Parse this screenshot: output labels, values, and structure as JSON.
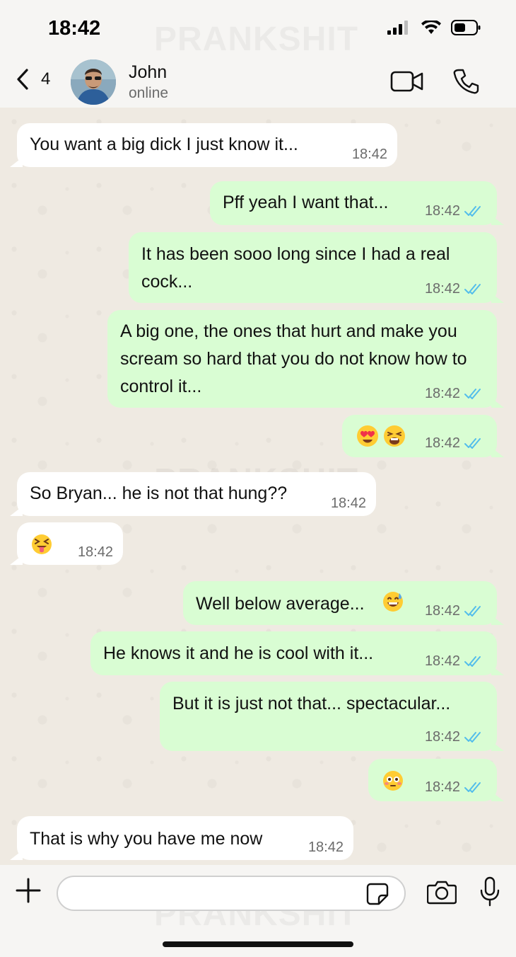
{
  "status_bar": {
    "time": "18:42"
  },
  "watermark": "PRANKSHIT",
  "header": {
    "back_count": "4",
    "contact_name": "John",
    "contact_status": "online"
  },
  "messages": [
    {
      "direction": "in",
      "text": "You want a big dick I just know it...",
      "time": "18:42"
    },
    {
      "direction": "out",
      "text": "Pff yeah I want that...",
      "time": "18:42",
      "status": "read"
    },
    {
      "direction": "out",
      "text": "It has been sooo long since I had a real cock...",
      "time": "18:42",
      "status": "read"
    },
    {
      "direction": "out",
      "text": "A big one, the ones that hurt and make you scream so hard that you do not know how to control it...",
      "time": "18:42",
      "status": "read"
    },
    {
      "direction": "out",
      "emojis": [
        "smiling-face-with-heart-eyes",
        "tired-face"
      ],
      "time": "18:42",
      "status": "read"
    },
    {
      "direction": "in",
      "text": "So Bryan... he is not that hung??",
      "time": "18:42"
    },
    {
      "direction": "in",
      "emojis": [
        "squinting-face-with-tongue"
      ],
      "time": "18:42"
    },
    {
      "direction": "out",
      "text": "Well below average...",
      "emoji_after": "grinning-face-with-sweat",
      "time": "18:42",
      "status": "read"
    },
    {
      "direction": "out",
      "text": "He knows it and he is cool with it...",
      "time": "18:42",
      "status": "read"
    },
    {
      "direction": "out",
      "text": "But it is just not that... spectacular...",
      "time": "18:42",
      "status": "read"
    },
    {
      "direction": "out",
      "emojis": [
        "flushed-face"
      ],
      "time": "18:42",
      "status": "read"
    },
    {
      "direction": "in",
      "text": "That is why you have me now",
      "time": "18:42"
    }
  ],
  "input": {
    "placeholder": "",
    "value": ""
  },
  "colors": {
    "incoming_bubble": "#ffffff",
    "outgoing_bubble": "#d9fdd3",
    "read_tick": "#53bdeb",
    "chat_background": "#efeae2"
  }
}
